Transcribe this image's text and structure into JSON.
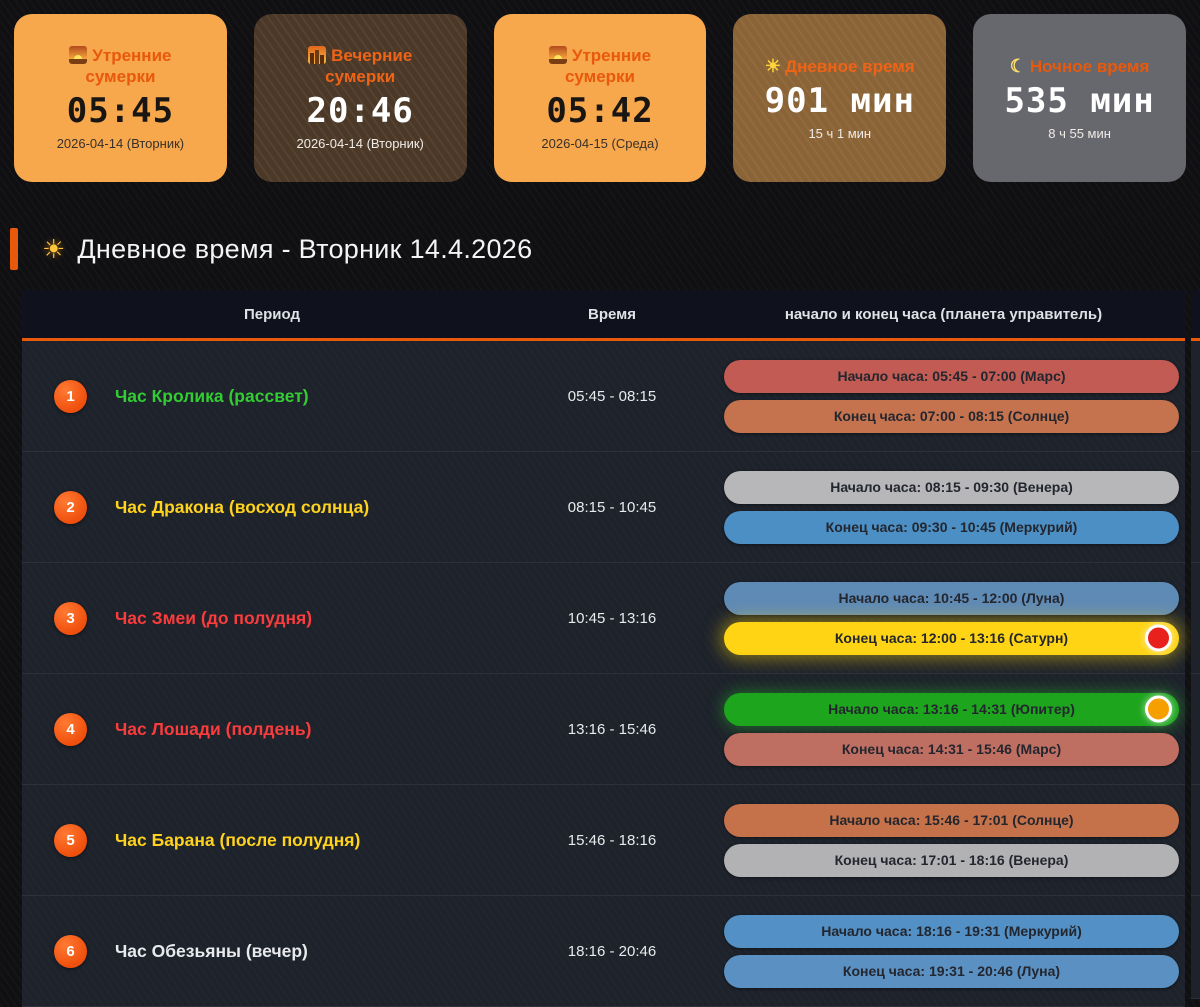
{
  "accent": "#e8590c",
  "cards": [
    {
      "icon": "sunrise-icon",
      "title": "Утренние сумерки",
      "value": "05:45",
      "subtitle": "2026-04-14 (Вторник)",
      "bg": "#f7a74c",
      "title_color": "#e8590c"
    },
    {
      "icon": "cityscape-dusk-icon",
      "title": "Вечерние сумерки",
      "value": "20:46",
      "subtitle": "2026-04-14 (Вторник)",
      "bg": "#4b3827",
      "title_color": "#ef6316"
    },
    {
      "icon": "sunrise-icon",
      "title": "Утренние сумерки",
      "value": "05:42",
      "subtitle": "2026-04-15 (Среда)",
      "bg": "#f7a74c",
      "title_color": "#e8590c"
    },
    {
      "icon": "sun-icon",
      "glyph": "☀",
      "glyph_color": "#ffd43b",
      "title": "Дневное время",
      "value": "901 мин",
      "subtitle": "15 ч 1 мин",
      "bg": "#8a6336",
      "title_color": "#ef6316"
    },
    {
      "icon": "moon-icon",
      "glyph": "☾",
      "glyph_color": "#ffe066",
      "title": "Ночное время",
      "value": "535 мин",
      "subtitle": "8 ч 55 мин",
      "bg": "#67676e",
      "title_color": "#e8590c"
    }
  ],
  "section": {
    "icon": "sun-icon",
    "glyph": "☀",
    "title": "Дневное время - Вторник 14.4.2026"
  },
  "table": {
    "headers": {
      "period": "Период",
      "time": "Время",
      "hours": "начало и конец часа (планета управитель)"
    },
    "rows": [
      {
        "num": "1",
        "name": "Час Кролика (рассвет)",
        "name_color": "#33cc33",
        "time": "05:45 - 08:15",
        "pills": [
          {
            "label": "Начало часа: 05:45 - 07:00 (Марс)",
            "bg": "#c15b53"
          },
          {
            "label": "Конец часа: 07:00 - 08:15 (Солнце)",
            "bg": "#c5734e"
          }
        ]
      },
      {
        "num": "2",
        "name": "Час Дракона (восход солнца)",
        "name_color": "#ffd21e",
        "time": "08:15 - 10:45",
        "pills": [
          {
            "label": "Начало часа: 08:15 - 09:30 (Венера)",
            "bg": "#b7b7ba"
          },
          {
            "label": "Конец часа: 09:30 - 10:45 (Меркурий)",
            "bg": "#4b8fc5"
          }
        ]
      },
      {
        "num": "3",
        "name": "Час Змеи (до полудня)",
        "name_color": "#fa3c3c",
        "time": "10:45 - 13:16",
        "pills": [
          {
            "label": "Начало часа: 10:45 - 12:00 (Луна)",
            "bg": "#5e8ab6"
          },
          {
            "label": "Конец часа: 12:00 - 13:16 (Сатурн)",
            "bg": "#ffd414",
            "indicator_color": "#e8211d"
          }
        ]
      },
      {
        "num": "4",
        "name": "Час Лошади (полдень)",
        "name_color": "#fa3c3c",
        "time": "13:16 - 15:46",
        "pills": [
          {
            "label": "Начало часа: 13:16 - 14:31 (Юпитер)",
            "bg": "#1da51d",
            "indicator_color": "#f59f00"
          },
          {
            "label": "Конец часа: 14:31 - 15:46 (Марс)",
            "bg": "#bf6e62"
          }
        ]
      },
      {
        "num": "5",
        "name": "Час Барана (после полудня)",
        "name_color": "#ffd21e",
        "time": "15:46 - 18:16",
        "pills": [
          {
            "label": "Начало часа: 15:46 - 17:01 (Солнце)",
            "bg": "#c5714a"
          },
          {
            "label": "Конец часа: 17:01 - 18:16 (Венера)",
            "bg": "#b2b2b5"
          }
        ]
      },
      {
        "num": "6",
        "name": "Час Обезьяны (вечер)",
        "name_color": "#e8eaed",
        "time": "18:16 - 20:46",
        "pills": [
          {
            "label": "Начало часа: 18:16 - 19:31 (Меркурий)",
            "bg": "#5390c5"
          },
          {
            "label": "Конец часа: 19:31 - 20:46 (Луна)",
            "bg": "#5b90c2"
          }
        ]
      }
    ]
  }
}
